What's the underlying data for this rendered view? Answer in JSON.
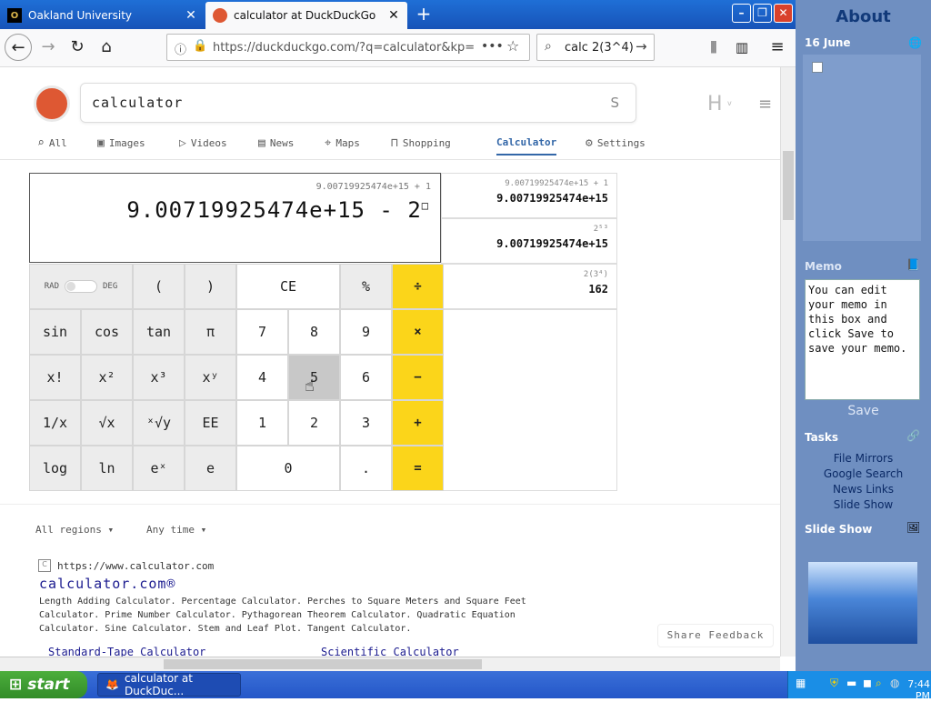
{
  "browser": {
    "tabs": [
      {
        "title": "Oakland University",
        "icon": "oakland-logo-icon"
      },
      {
        "title": "calculator at DuckDuckGo",
        "icon": "duckduckgo-icon"
      }
    ],
    "url": "https://duckduckgo.com/?q=calculator&kp=",
    "search_box": "calc 2(3^4)"
  },
  "ddg": {
    "query": "calculator",
    "clear_glyph": "S",
    "nav": [
      "All",
      "Images",
      "Videos",
      "News",
      "Maps",
      "Shopping",
      "Calculator",
      "Settings"
    ],
    "active_tab": "Calculator"
  },
  "calculator": {
    "display_history": "9.00719925474e+15 + 1",
    "display_main": "9.00719925474e+15 - 2",
    "display_exponent": "□",
    "toggle": {
      "left": "RAD",
      "right": "DEG"
    },
    "history": [
      {
        "q": "9.00719925474e+15 + 1",
        "a": "9.00719925474e+15"
      },
      {
        "q": "2⁵³",
        "a": "9.00719925474e+15"
      },
      {
        "q": "2(3⁴)",
        "a": "162"
      }
    ],
    "keys": {
      "row1": [
        "(",
        ")",
        "CE",
        "%",
        "÷"
      ],
      "row2": [
        "sin",
        "cos",
        "tan",
        "π",
        "7",
        "8",
        "9",
        "×"
      ],
      "row3": [
        "x!",
        "x²",
        "x³",
        "xʸ",
        "4",
        "5",
        "6",
        "−"
      ],
      "row4": [
        "1/x",
        "√x",
        "ˣ√y",
        "EE",
        "1",
        "2",
        "3",
        "+"
      ],
      "row5": [
        "log",
        "ln",
        "eˣ",
        "e",
        "0",
        ".",
        "="
      ]
    }
  },
  "filters": {
    "region": "All regions ▾",
    "time": "Any time ▾"
  },
  "result": {
    "url": "https://www.calculator.com",
    "title": "calculator.com®",
    "snippet_line1": "Length Adding Calculator. Percentage Calculator. Perches to Square Meters and Square Feet",
    "snippet_line2": "Calculator. Prime Number Calculator. Pythagorean Theorem Calculator. Quadratic Equation",
    "snippet_line3": "Calculator. Sine Calculator. Stem and Leaf Plot. Tangent Calculator.",
    "sublink1": "Standard-Tape Calculator",
    "sublink2": "Scientific Calculator"
  },
  "share_feedback": "Share Feedback",
  "sidebar": {
    "title": "About",
    "date": "16 June",
    "memo_header": "Memo",
    "memo_text": "You can edit your memo in this box and click Save to save your memo.",
    "save": "Save",
    "tasks_header": "Tasks",
    "tasks": [
      "File Mirrors",
      "Google Search",
      "News Links",
      "Slide Show"
    ],
    "slideshow_header": "Slide Show"
  },
  "taskbar": {
    "start": "start",
    "window": "calculator at DuckDuc...",
    "clock": "7:44 PM"
  }
}
